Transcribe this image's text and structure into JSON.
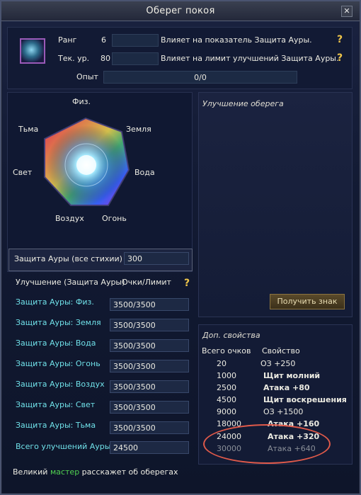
{
  "window": {
    "title": "Оберег покоя",
    "close": "✕"
  },
  "top": {
    "rank_label": "Ранг",
    "rank_value": "6",
    "rank_desc": "Влияет на показатель Защита Ауры.",
    "level_label": "Тек. ур.",
    "level_value": "80",
    "level_desc": "Влияет на лимит улучшений Защита Ауры.",
    "exp_label": "Опыт",
    "exp_value": "0/0",
    "exp_progress": 0,
    "help": "?"
  },
  "elements": {
    "phys": "Физ.",
    "earth": "Земля",
    "water": "Вода",
    "fire": "Огонь",
    "air": "Воздух",
    "light": "Свет",
    "dark": "Тьма"
  },
  "aura": {
    "label": "Защита Ауры (все стихии)",
    "value": "300"
  },
  "upgrades": {
    "header": "Улучшение (Защита Ауры)",
    "header2": "Очки/Лимит",
    "help": "?",
    "rows": [
      {
        "label": "Защита Ауры: Физ.",
        "value": "3500/3500"
      },
      {
        "label": "Защита Ауры: Земля",
        "value": "3500/3500"
      },
      {
        "label": "Защита Ауры: Вода",
        "value": "3500/3500"
      },
      {
        "label": "Защита Ауры: Огонь",
        "value": "3500/3500"
      },
      {
        "label": "Защита Ауры: Воздух",
        "value": "3500/3500"
      },
      {
        "label": "Защита Ауры: Свет",
        "value": "3500/3500"
      },
      {
        "label": "Защита Ауры: Тьма",
        "value": "3500/3500"
      }
    ],
    "total_label": "Всего улучшений Ауры",
    "total_value": "24500"
  },
  "amulet_upgrade": {
    "title": "Улучшение оберега",
    "button": "Получить знак"
  },
  "properties": {
    "title": "Доп. свойства",
    "col_points": "Всего очков",
    "col_prop": "Свойство",
    "rows": [
      {
        "points": "20",
        "prop": "ОЗ +250"
      },
      {
        "points": "1000",
        "prop": "Щит молний"
      },
      {
        "points": "2500",
        "prop": "Атака +80"
      },
      {
        "points": "4500",
        "prop": "Щит воскрешения"
      },
      {
        "points": "9000",
        "prop": "ОЗ +1500"
      },
      {
        "points": "18000",
        "prop": "Атака +160"
      },
      {
        "points": "24000",
        "prop": "Атака +320"
      },
      {
        "points": "30000",
        "prop": "Атака +640"
      }
    ]
  },
  "footer": {
    "part1": "Великий ",
    "part2": "мастер",
    "part3": " расскажет об оберегах"
  }
}
